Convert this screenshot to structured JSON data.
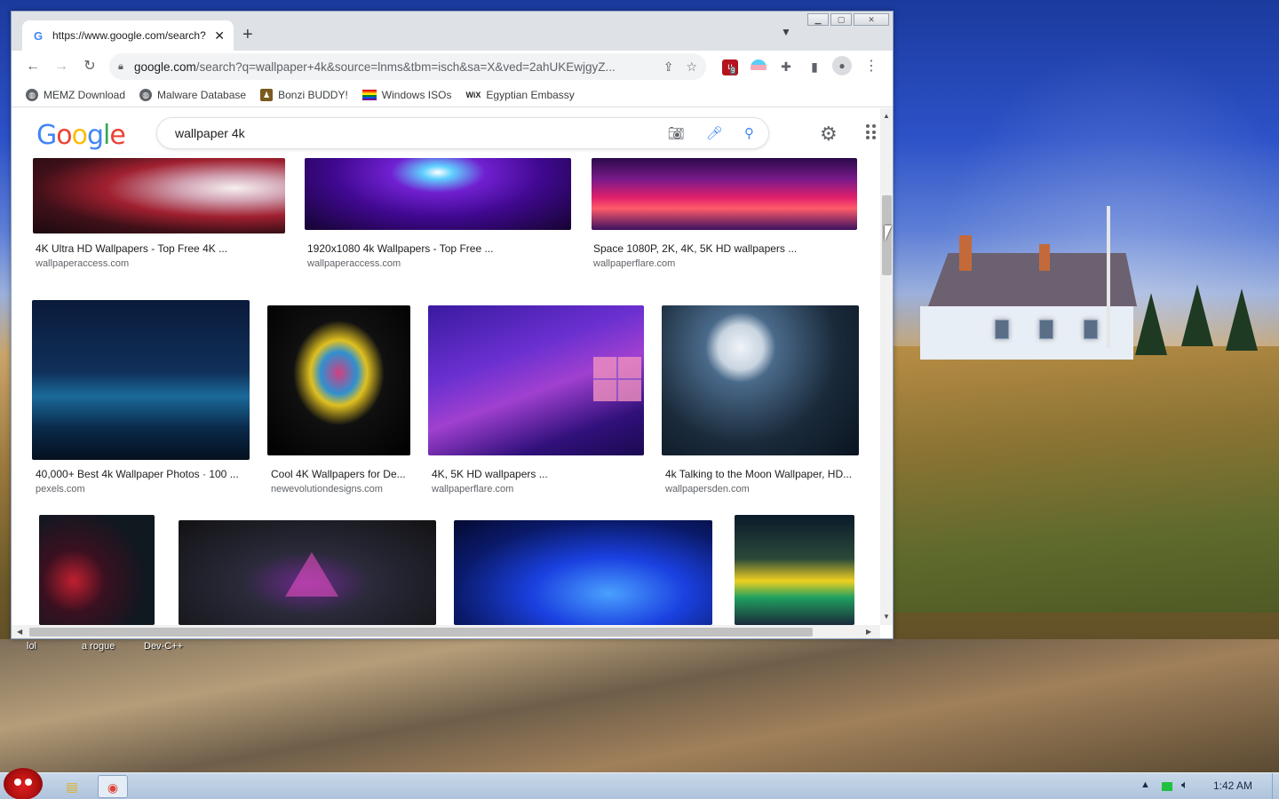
{
  "browser": {
    "tab_title": "https://www.google.com/search?",
    "tab_close": "✕",
    "new_tab": "+",
    "url_main": "google.com",
    "url_rest": "/search?q=wallpaper+4k&source=lnms&tbm=isch&sa=X&ved=2ahUKEwjgyZ...",
    "extension_badge": "9",
    "bookmarks": [
      {
        "label": "MEMZ Download",
        "color": "#5f6368"
      },
      {
        "label": "Malware Database",
        "color": "#5f6368"
      },
      {
        "label": "Bonzi BUDDY!",
        "color": "#7a5a1e"
      },
      {
        "label": "Windows ISOs",
        "color": "#e040a0"
      },
      {
        "label": "Egyptian Embassy",
        "color": "#202124"
      }
    ]
  },
  "google": {
    "logo_letters": [
      "G",
      "o",
      "o",
      "g",
      "l",
      "e"
    ],
    "logo_colors": [
      "#4285f4",
      "#ea4335",
      "#fbbc05",
      "#4285f4",
      "#34a853",
      "#ea4335"
    ],
    "query": "wallpaper 4k"
  },
  "results_row1": [
    {
      "caption": "4K Ultra HD Wallpapers - Top Free 4K ...",
      "source": "wallpaperaccess.com"
    },
    {
      "caption": "1920x1080 4k Wallpapers - Top Free ...",
      "source": "wallpaperaccess.com"
    },
    {
      "caption": "Space 1080P, 2K, 4K, 5K HD wallpapers ...",
      "source": "wallpaperflare.com"
    }
  ],
  "results_row2": [
    {
      "caption": "40,000+ Best 4k Wallpaper Photos · 100 ...",
      "source": "pexels.com"
    },
    {
      "caption": "Cool 4K Wallpapers for De...",
      "source": "newevolutiondesigns.com"
    },
    {
      "caption": "4K, 5K HD wallpapers ...",
      "source": "wallpaperflare.com"
    },
    {
      "caption": "4k Talking to the Moon Wallpaper, HD...",
      "source": "wallpapersden.com"
    }
  ],
  "desktop_icons": [
    "lol",
    "a rogue",
    "Dev-C++"
  ],
  "taskbar": {
    "clock": "1:42 AM"
  }
}
